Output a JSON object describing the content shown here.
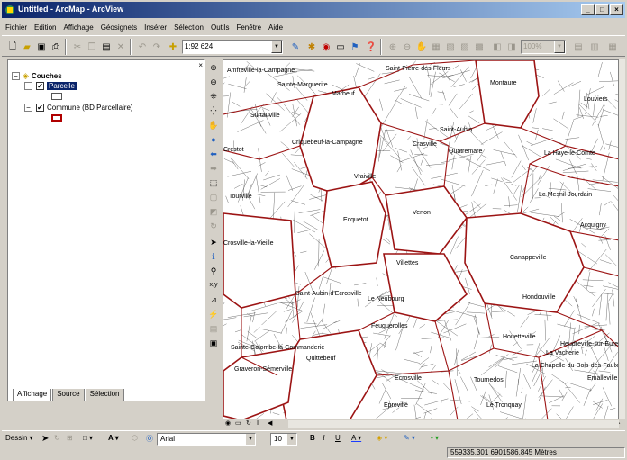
{
  "window": {
    "title": "Untitled - ArcMap - ArcView"
  },
  "menu": [
    "Fichier",
    "Edition",
    "Affichage",
    "Géosignets",
    "Insérer",
    "Sélection",
    "Outils",
    "Fenêtre",
    "Aide"
  ],
  "toolbar": {
    "scale": "1:92 624",
    "zoom_percent": "100%"
  },
  "toc": {
    "root": "Couches",
    "layers": [
      {
        "name": "Parcelle",
        "checked": true,
        "symbol_color": "#ffffff"
      },
      {
        "name": "Commune (BD Parcellaire)",
        "checked": true,
        "symbol_color": "#b00000"
      }
    ],
    "tabs": [
      "Affichage",
      "Source",
      "Sélection"
    ]
  },
  "map": {
    "labels": [
      "Amfreville-la-Campagne",
      "Sainte-Marguerite",
      "Marbeuf",
      "Montaure",
      "Louviers",
      "Saint-Pierre-des-Fleurs",
      "Criquebeuf-la-Campagne",
      "Crasville",
      "Quatremare",
      "La Haye-le-Comte",
      "Ecquetot",
      "Vraiville",
      "Le Mesnil-Jourdain",
      "Venon",
      "Acquigny",
      "Villettes",
      "Canappeville",
      "Crosville-la-Vieille",
      "Sainte-Colombe-la-Commanderie",
      "Quittebeuf",
      "Feuguerolles",
      "Houetteville",
      "Saint-Aubin-d'Ecrosville",
      "Le Neubourg",
      "La Vacherie",
      "Heudreville-sur-Eure",
      "La Chapelle-du-Bois-des-Faulx",
      "Emalleville",
      "Graveron-Sémerville",
      "Hondouville",
      "Tournedos",
      "Ecrosville",
      "Epreville",
      "Le Tronquay",
      "Saint-Aubin",
      "Surtauville",
      "Crestot",
      "Tourville"
    ]
  },
  "drawbar": {
    "dessin": "Dessin",
    "font": "Arial",
    "size": "10"
  },
  "status": {
    "coords": "559335,301  6901586,845 Mètres"
  }
}
